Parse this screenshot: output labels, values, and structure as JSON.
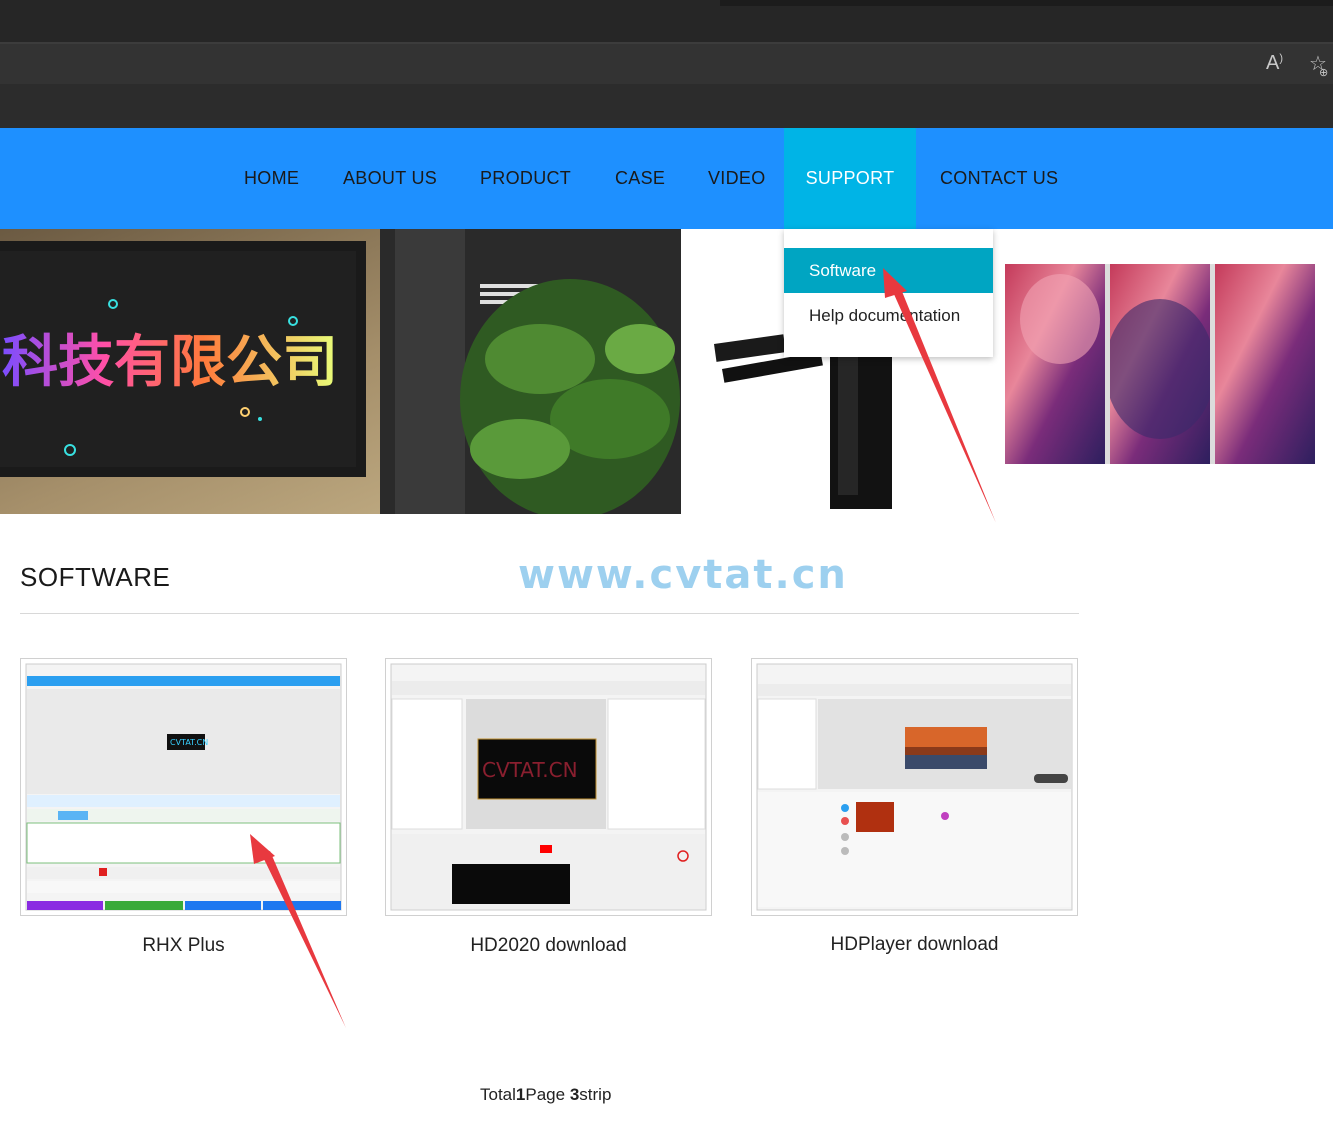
{
  "browser": {
    "read_aloud_icon": "read-aloud-icon",
    "favorite_icon": "add-favorite-icon"
  },
  "nav": {
    "items": [
      "HOME",
      "ABOUT US",
      "PRODUCT",
      "CASE",
      "VIDEO",
      "SUPPORT",
      "CONTACT US"
    ],
    "active": "SUPPORT",
    "bg_color": "#1e90ff",
    "active_color": "#00b4e6"
  },
  "dropdown": {
    "items": [
      "Software",
      "Help documentation"
    ],
    "active": "Software",
    "active_color": "#00a5c2"
  },
  "banner": {
    "sign_text": "科技有限公司"
  },
  "section": {
    "title": "SOFTWARE",
    "watermark": "www.cvtat.cn"
  },
  "cards": [
    {
      "label": "RHX Plus",
      "screen_text": "CVTAT.CN"
    },
    {
      "label": "HD2020 download",
      "screen_text": "CVTAT.CN"
    },
    {
      "label": "HDPlayer download",
      "screen_text": ""
    }
  ],
  "pagination": {
    "total_label": "Total",
    "total": "1",
    "page_label": "Page",
    "count": "3",
    "unit": "strip"
  },
  "annotation": {
    "arrow_color": "#e8393f"
  }
}
